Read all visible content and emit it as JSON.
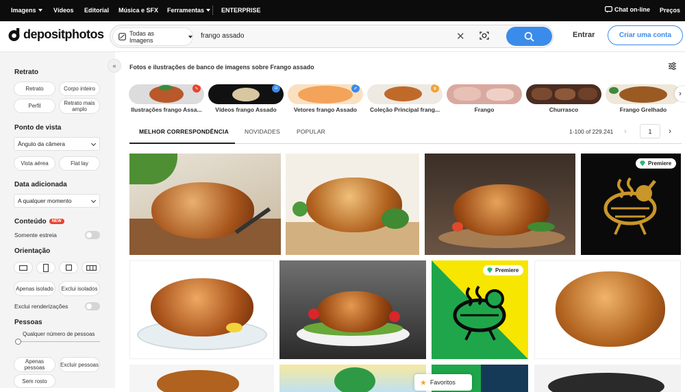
{
  "topnav": {
    "items": [
      "Imagens",
      "Vídeos",
      "Editorial",
      "Música e SFX",
      "Ferramentas",
      "ENTERPRISE"
    ],
    "chat": "Chat on-line",
    "pricing": "Preços"
  },
  "header": {
    "logo": "depositphotos",
    "category": "Todas as Imagens",
    "search_value": "frango assado",
    "signin": "Entrar",
    "signup": "Criar uma conta"
  },
  "sidebar": {
    "portrait_title": "Retrato",
    "portrait_options": [
      "Retrato",
      "Corpo inteiro",
      "Perfil",
      "Retrato mais amplo"
    ],
    "viewpoint_title": "Ponto de vista",
    "viewpoint_select": "Ângulo da câmera",
    "viewpoint_options": [
      "Vista aérea",
      "Flat lay"
    ],
    "date_title": "Data adicionada",
    "date_select": "A qualquer momento",
    "content_title": "Conteúdo",
    "new_badge": "NEW",
    "only_debut": "Somente estreia",
    "orientation_title": "Orientação",
    "isolation_options": [
      "Apenas isolado",
      "Exclui isolados"
    ],
    "exclude_renders": "Exclui renderizações",
    "people_title": "Pessoas",
    "people_slider_label": "Qualquer número de pessoas",
    "people_options": [
      "Apenas pessoas",
      "Excluir pessoas",
      "Sem rosto"
    ]
  },
  "main": {
    "title": "Fotos e ilustrações de banco de imagens sobre Frango assado",
    "related": [
      {
        "label": "Ilustrações frango Assa...",
        "badge": "pencil",
        "badge_color": "#e8432e",
        "bg": "#d8d8d8"
      },
      {
        "label": "Vídeos frango Assado",
        "badge": "camera",
        "badge_color": "#3b8bea",
        "bg": "#111111"
      },
      {
        "label": "Vetores frango Assado",
        "badge": "pen",
        "badge_color": "#3b8bea",
        "bg": "#f3a35a"
      },
      {
        "label": "Coleção Principal frang...",
        "badge": "crown",
        "badge_color": "#f0a33a",
        "bg": "#e9e3da"
      },
      {
        "label": "Frango",
        "badge": "",
        "badge_color": "",
        "bg": "#d9a9a0"
      },
      {
        "label": "Churrasco",
        "badge": "",
        "badge_color": "",
        "bg": "#4a2d20"
      },
      {
        "label": "Frango Grelhado",
        "badge": "",
        "badge_color": "",
        "bg": "#8a5a2a"
      }
    ],
    "tabs": [
      "MELHOR CORRESPONDÊNCIA",
      "NOVIDADES",
      "POPULAR"
    ],
    "count": "1-100 of 229.241",
    "page": "1",
    "premium_label": "Premiere",
    "favorites": "Favoritos"
  },
  "colors": {
    "accent": "#3b8bea",
    "premium_green": "#2bb673",
    "new_red": "#e8432e"
  }
}
